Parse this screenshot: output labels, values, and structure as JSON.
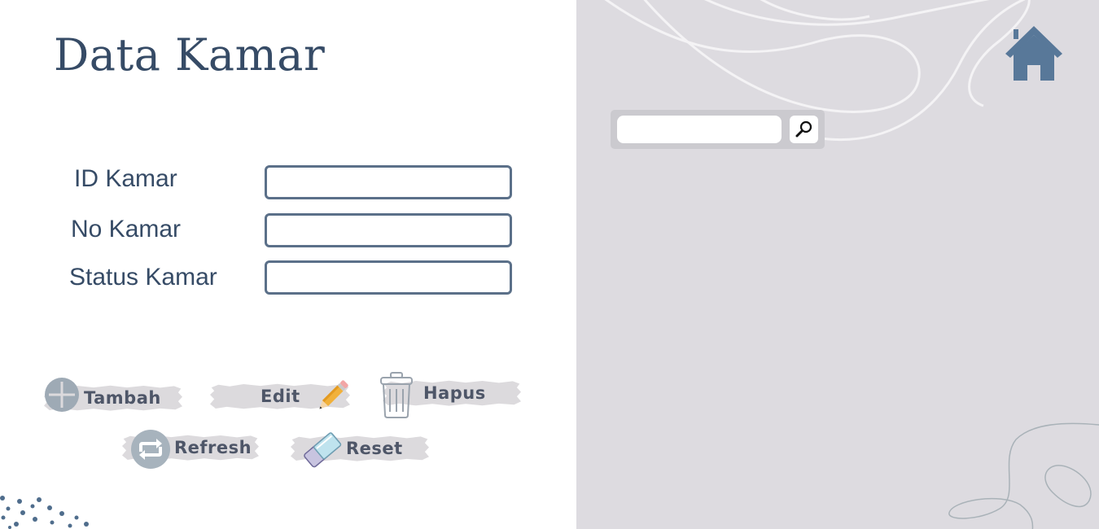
{
  "page": {
    "title": "Data Kamar"
  },
  "form": {
    "fields": [
      {
        "label": "ID Kamar",
        "value": "",
        "placeholder": ""
      },
      {
        "label": "No Kamar",
        "value": "",
        "placeholder": ""
      },
      {
        "label": "Status Kamar",
        "value": "",
        "placeholder": ""
      }
    ]
  },
  "actions": {
    "add": {
      "label": "Tambah",
      "icon": "plus-circle-icon"
    },
    "edit": {
      "label": "Edit",
      "icon": "pencil-icon"
    },
    "delete": {
      "label": "Hapus",
      "icon": "trash-icon"
    },
    "refresh": {
      "label": "Refresh",
      "icon": "repeat-icon"
    },
    "reset": {
      "label": "Reset",
      "icon": "eraser-icon"
    }
  },
  "search": {
    "value": "",
    "placeholder": "",
    "icon": "search-icon"
  },
  "nav": {
    "home_icon": "home-icon"
  },
  "colors": {
    "accent": "#364b66",
    "input_border": "#5b7089",
    "button_bg": "#dcdadd",
    "right_panel_bg": "#dddbe0",
    "home_icon": "#587899"
  }
}
